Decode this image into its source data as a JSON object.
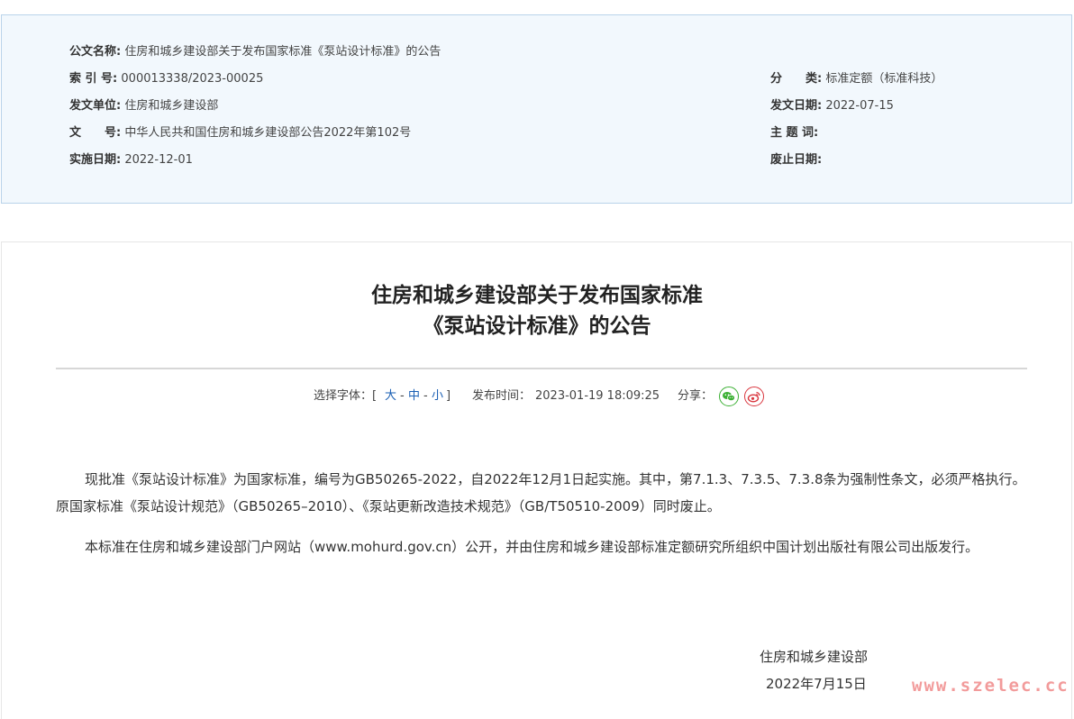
{
  "meta": {
    "doc_name_label": "公文名称:",
    "doc_name": "住房和城乡建设部关于发布国家标准《泵站设计标准》的公告",
    "index_label": "索 引 号:",
    "index": "000013338/2023-00025",
    "category_label": "分　　类:",
    "category": "标准定额（标准科技）",
    "issuer_label": "发文单位:",
    "issuer": "住房和城乡建设部",
    "issue_date_label": "发文日期:",
    "issue_date": "2022-07-15",
    "doc_no_label": "文　　号:",
    "doc_no": "中华人民共和国住房和城乡建设部公告2022年第102号",
    "keywords_label": "主 题 词:",
    "keywords": "",
    "effective_label": "实施日期:",
    "effective": "2022-12-01",
    "abolish_label": "废止日期:",
    "abolish": ""
  },
  "article": {
    "title_line1": "住房和城乡建设部关于发布国家标准",
    "title_line2": "《泵站设计标准》的公告",
    "paragraphs": [
      "现批准《泵站设计标准》为国家标准，编号为GB50265-2022，自2022年12月1日起实施。其中，第7.1.3、7.3.5、7.3.8条为强制性条文，必须严格执行。原国家标准《泵站设计规范》（GB50265–2010）、《泵站更新改造技术规范》（GB/T50510-2009）同时废止。",
      "本标准在住房和城乡建设部门户网站（www.mohurd.gov.cn）公开，并由住房和城乡建设部标准定额研究所组织中国计划出版社有限公司出版发行。"
    ],
    "signature": "住房和城乡建设部",
    "sign_date": "2022年7月15日"
  },
  "toolbar": {
    "font_label": "选择字体：[",
    "font_large": "大",
    "sep1": "-",
    "font_medium": "中",
    "sep2": "-",
    "font_small": "小",
    "font_end": "]",
    "publish_label": "发布时间：",
    "publish_time": "2023-01-19 18:09:25",
    "share_label": "分享："
  },
  "icons": {
    "wechat": "wechat-icon",
    "weibo": "weibo-icon"
  },
  "colors": {
    "meta_bg": "#f2f8fd",
    "meta_border": "#b9d3ea",
    "link": "#1a5fb4",
    "wechat": "#3cb034",
    "weibo": "#d9363e"
  },
  "watermark": "www.szelec.cc"
}
